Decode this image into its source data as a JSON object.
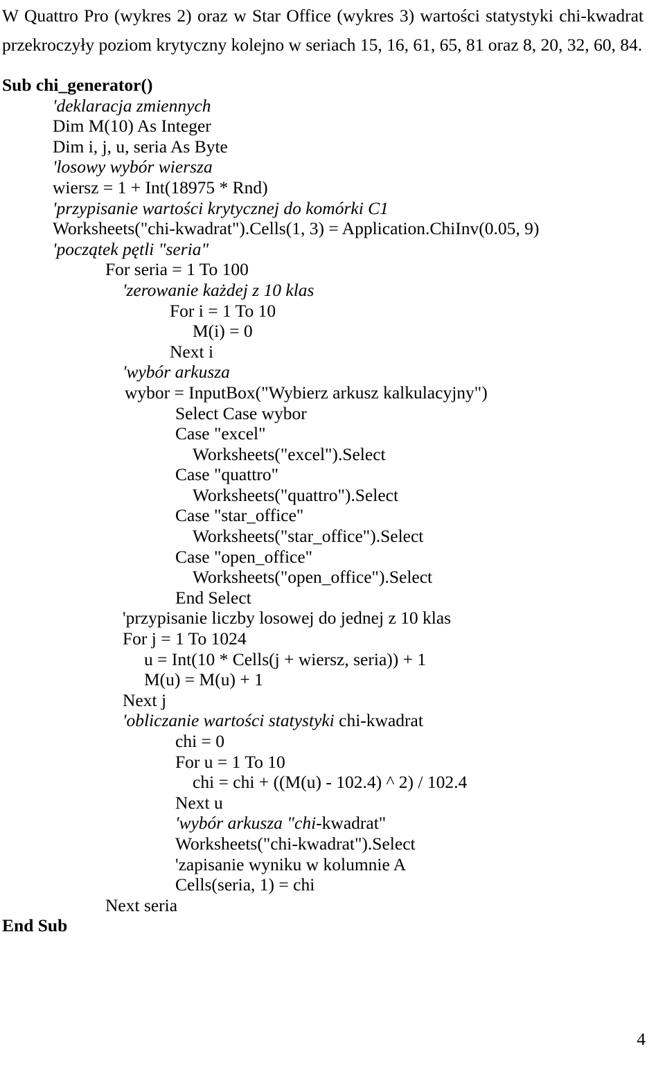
{
  "document": {
    "intro": {
      "line1": "W Quattro Pro (wykres 2) oraz w Star Office (wykres 3) wartości statystyki chi-kwadrat",
      "line2": "przekroczyły poziom krytyczny kolejno w seriach 15, 16, 61, 65, 81 oraz 8, 20, 32, 60, 84."
    },
    "code": {
      "lines": [
        {
          "indent": "x0",
          "style": "bold",
          "text": "Sub chi_generator()"
        },
        {
          "indent": "x1",
          "style": "italic",
          "text": "'deklaracja zmiennych"
        },
        {
          "indent": "x1",
          "style": "normal",
          "text": "Dim M(10) As Integer"
        },
        {
          "indent": "x1",
          "style": "normal",
          "text": "Dim i, j, u, seria As Byte"
        },
        {
          "indent": "x1",
          "style": "italic",
          "text": "'losowy wybór wiersza"
        },
        {
          "indent": "x1",
          "style": "normal",
          "text": "wiersz = 1 + Int(18975 * Rnd)"
        },
        {
          "indent": "x1",
          "style": "italic",
          "text": "'przypisanie wartości krytycznej do komórki C1"
        },
        {
          "indent": "x1",
          "style": "normal",
          "text": "Worksheets(\"chi-kwadrat\").Cells(1, 3) = Application.ChiInv(0.05, 9)"
        },
        {
          "indent": "x1",
          "style": "italic",
          "text": "'początek pętli \"seria\""
        },
        {
          "indent": "x2",
          "style": "normal",
          "text": "For seria = 1 To 100"
        },
        {
          "indent": "x3",
          "style": "italic",
          "text": "'zerowanie każdej z 10 klas"
        },
        {
          "indent": "x5",
          "style": "normal",
          "text": "For i = 1 To 10"
        },
        {
          "indent": "x7",
          "style": "normal",
          "text": "M(i) = 0"
        },
        {
          "indent": "x5",
          "style": "normal",
          "text": "Next i"
        },
        {
          "indent": "x3",
          "style": "italic",
          "text": "'wybór arkusza"
        },
        {
          "indent": "x8",
          "style": "normal",
          "text": "wybor = InputBox(\"Wybierz arkusz kalkulacyjny\")"
        },
        {
          "indent": "x6",
          "style": "normal",
          "text": "Select Case wybor"
        },
        {
          "indent": "x6",
          "style": "normal",
          "text": "Case \"excel\""
        },
        {
          "indent": "x7",
          "style": "normal",
          "text": "Worksheets(\"excel\").Select"
        },
        {
          "indent": "x6",
          "style": "normal",
          "text": "Case \"quattro\""
        },
        {
          "indent": "x7",
          "style": "normal",
          "text": "Worksheets(\"quattro\").Select"
        },
        {
          "indent": "x6",
          "style": "normal",
          "text": "Case \"star_office\""
        },
        {
          "indent": "x7",
          "style": "normal",
          "text": "Worksheets(\"star_office\").Select"
        },
        {
          "indent": "x6",
          "style": "normal",
          "text": "Case \"open_office\""
        },
        {
          "indent": "x7",
          "style": "normal",
          "text": "Worksheets(\"open_office\").Select"
        },
        {
          "indent": "x6",
          "style": "normal",
          "text": "End Select"
        },
        {
          "indent": "x3",
          "style": "normal",
          "text": "'przypisanie liczby losowej do jednej z 10 klas"
        },
        {
          "indent": "x3",
          "style": "normal",
          "text": "For j = 1 To 1024"
        },
        {
          "indent": "x4",
          "style": "normal",
          "text": "u = Int(10 * Cells(j + wiersz, seria)) + 1"
        },
        {
          "indent": "x4",
          "style": "normal",
          "text": "M(u) = M(u) + 1"
        },
        {
          "indent": "x3",
          "style": "normal",
          "text": "Next j"
        },
        {
          "indent": "x3",
          "style": "split",
          "text": "'obliczanie wartości statystyki chi-kwadrat",
          "italic_part": "'obliczanie wartości statystyki ",
          "plain_part": "chi-kwadrat"
        },
        {
          "indent": "x6",
          "style": "normal",
          "text": "chi = 0"
        },
        {
          "indent": "x6",
          "style": "normal",
          "text": "For u = 1 To 10"
        },
        {
          "indent": "x7",
          "style": "normal",
          "text": "chi = chi + ((M(u) - 102.4) ^ 2) / 102.4"
        },
        {
          "indent": "x6",
          "style": "normal",
          "text": "Next u"
        },
        {
          "indent": "x6",
          "style": "split",
          "text": "'wybór arkusza \"chi-kwadrat\"",
          "italic_part": "'wybór arkusza \"chi",
          "plain_part": "-kwadrat\""
        },
        {
          "indent": "x6",
          "style": "normal",
          "text": "Worksheets(\"chi-kwadrat\").Select"
        },
        {
          "indent": "x6",
          "style": "normal",
          "text": "'zapisanie wyniku w kolumnie A"
        },
        {
          "indent": "x6",
          "style": "normal",
          "text": "Cells(seria, 1) = chi"
        },
        {
          "indent": "x2",
          "style": "normal",
          "text": "Next seria"
        },
        {
          "indent": "x0",
          "style": "bold",
          "text": "End Sub"
        }
      ]
    },
    "footer": {
      "page_number": "4"
    }
  }
}
